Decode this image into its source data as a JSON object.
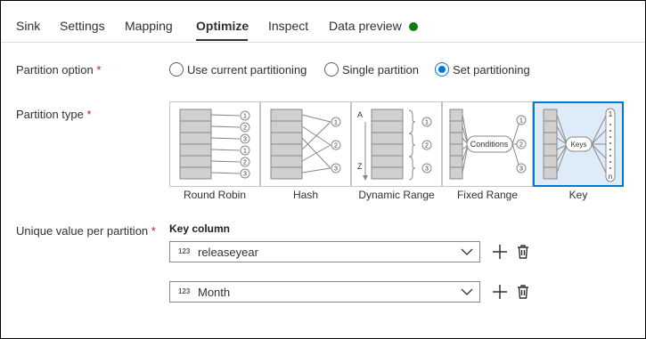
{
  "tabs": [
    {
      "label": "Sink"
    },
    {
      "label": "Settings"
    },
    {
      "label": "Mapping"
    },
    {
      "label": "Optimize"
    },
    {
      "label": "Inspect"
    },
    {
      "label": "Data preview"
    }
  ],
  "active_tab": "Optimize",
  "status_color": "#107c10",
  "partition_option": {
    "label": "Partition option",
    "required_mark": "*",
    "options": [
      {
        "label": "Use current partitioning",
        "selected": false
      },
      {
        "label": "Single partition",
        "selected": false
      },
      {
        "label": "Set partitioning",
        "selected": true
      }
    ]
  },
  "partition_type": {
    "label": "Partition type",
    "required_mark": "*",
    "types": [
      {
        "label": "Round Robin",
        "selected": false
      },
      {
        "label": "Hash",
        "selected": false
      },
      {
        "label": "Dynamic Range",
        "selected": false
      },
      {
        "label": "Fixed Range",
        "selected": false
      },
      {
        "label": "Key",
        "selected": true
      }
    ],
    "glyphs": {
      "round_robin": [
        "1",
        "2",
        "3",
        "1",
        "2",
        "3"
      ],
      "hash": [
        "1",
        "2",
        "3"
      ],
      "dynamic_range_axis": [
        "A",
        "Z"
      ],
      "dynamic_range": [
        "1",
        "2",
        "3"
      ],
      "fixed_range_box": "Conditions",
      "fixed_range": [
        "1",
        "2",
        "3"
      ],
      "key_box": "Keys",
      "key_top": "1",
      "key_bottom": "n"
    }
  },
  "unique_value": {
    "label": "Unique value per partition",
    "required_mark": "*",
    "column_header": "Key column",
    "keys": [
      {
        "type_tag": "123",
        "value": "releaseyear"
      },
      {
        "type_tag": "123",
        "value": "Month"
      }
    ]
  },
  "colors": {
    "accent": "#0078d4",
    "selected_bg": "#deecf9",
    "required": "#a4262c"
  }
}
